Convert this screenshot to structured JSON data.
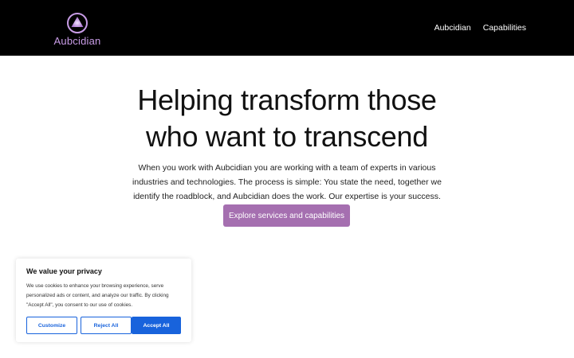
{
  "header": {
    "brand_name": "Aubcidian",
    "brand_color": "#c89ce6",
    "logo_icon": "triangle-in-circle-icon",
    "nav": [
      {
        "label": "Aubcidian"
      },
      {
        "label": "Capabilities"
      }
    ]
  },
  "hero": {
    "title_line1": "Helping transform those",
    "title_line2": "who want to transcend",
    "description": "When you work with Aubcidian you are working with a team of experts in various industries and technologies. The process is simple: You state the need, together we identify the roadblock, and Aubcidian does the work. Our expertise is your success.",
    "cta_label": "Explore services and capabilities",
    "cta_color": "#a56fb0"
  },
  "cookie_banner": {
    "title": "We value your privacy",
    "body": "We use cookies to enhance your browsing experience, serve personalized ads or content, and analyze our traffic. By clicking \"Accept All\", you consent to our use of cookies.",
    "customize_label": "Customize",
    "reject_label": "Reject All",
    "accept_label": "Accept All",
    "accent_color": "#1863dc"
  }
}
